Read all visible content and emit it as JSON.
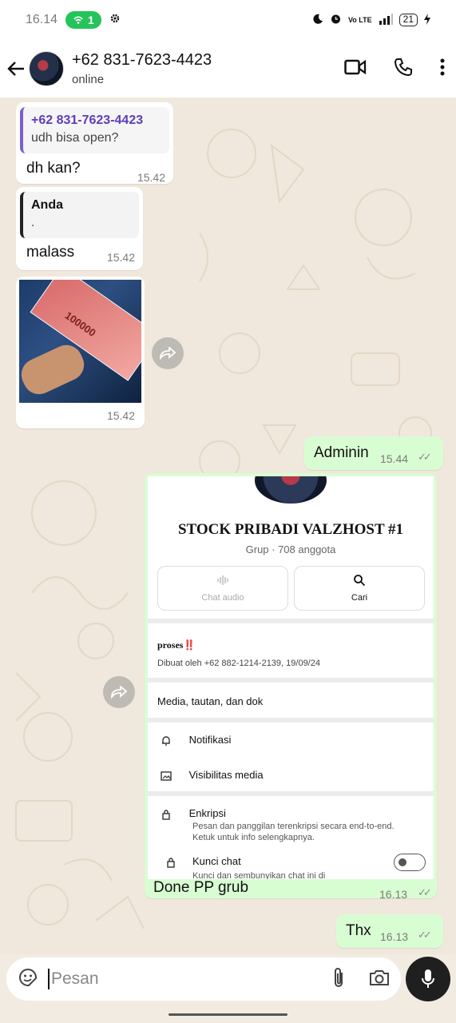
{
  "status_bar": {
    "time": "16.14",
    "hotspot_count": "1",
    "network": "4G",
    "volte": "Vo LTE",
    "battery": "21"
  },
  "header": {
    "contact_name": "+62 831-7623-4423",
    "contact_status": "online"
  },
  "messages": {
    "m1": {
      "quote_name": "+62 831-7623-4423",
      "quote_text": "udh bisa open?",
      "text": "dh kan?",
      "time": "15.42"
    },
    "m2": {
      "quote_name": "Anda",
      "quote_text": ".",
      "text": "malass",
      "time": "15.42"
    },
    "m3": {
      "image_text": "100000",
      "time": "15.42"
    },
    "m4": {
      "text": "Adminin",
      "time": "15.44"
    },
    "m5": {
      "group_title": "STOCK PRIBADI VALZHOST #1",
      "group_subtitle": "Grup · 708 anggota",
      "btn_audio": "Chat audio",
      "btn_search": "Cari",
      "desc_title": "proses‼️",
      "desc_created": "Dibuat oleh +62 882-1214-2139, 19/09/24",
      "media_row": "Media, tautan, dan dok",
      "notif_row": "Notifikasi",
      "visibility_row": "Visibilitas media",
      "encrypt_row": "Enkripsi",
      "encrypt_desc1": "Pesan dan panggilan terenkripsi secara end-to-end.",
      "encrypt_desc2": "Ketuk untuk info selengkapnya.",
      "lock_row": "Kunci chat",
      "lock_desc": "Kunci dan sembunyikan chat ini di",
      "caption": "Done PP grub",
      "time": "16.13"
    },
    "m6": {
      "text": "Thx",
      "time": "16.13"
    }
  },
  "input": {
    "placeholder": "Pesan"
  },
  "colors": {
    "accent_green": "#25c45a",
    "outgoing_bubble": "#d9fdd3",
    "read_ticks": "#53bdeb",
    "chat_bg": "#f0e8dc"
  }
}
